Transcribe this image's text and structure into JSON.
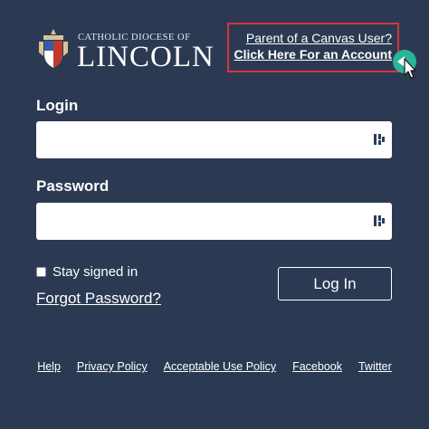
{
  "logo": {
    "line1": "CATHOLIC DIOCESE OF",
    "line2": "LINCOLN",
    "crest_icon": "diocese-crest-icon"
  },
  "parent_link": {
    "line1": "Parent of a Canvas User?",
    "line2": "Click Here For an Account"
  },
  "form": {
    "login_label": "Login",
    "login_value": "",
    "password_label": "Password",
    "password_value": "",
    "password_manager_icon": "password-manager-icon",
    "stay_signed_in": "Stay signed in",
    "stay_signed_in_checked": false,
    "forgot_password": "Forgot Password?",
    "login_button": "Log In"
  },
  "footer": {
    "links": [
      "Help",
      "Privacy Policy",
      "Acceptable Use Policy",
      "Facebook",
      "Twitter"
    ]
  },
  "colors": {
    "background": "#2b3a52",
    "highlight_border": "#d8343a",
    "arrow_badge": "#2bb39a"
  }
}
